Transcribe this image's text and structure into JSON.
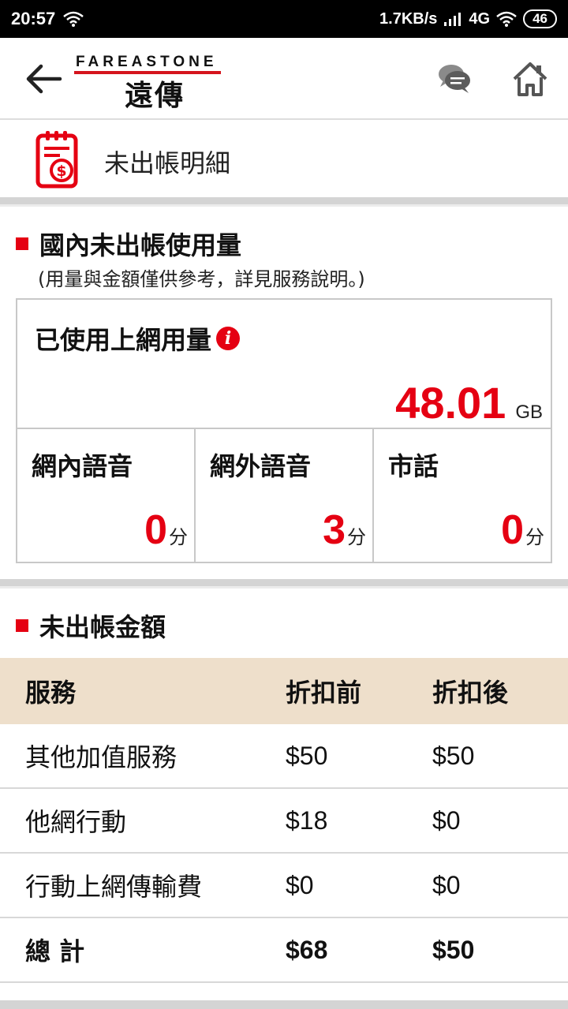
{
  "status": {
    "time": "20:57",
    "speed": "1.7KB/s",
    "network": "4G",
    "battery": "46"
  },
  "header": {
    "logo_text": "FAREASTONE",
    "logo_zh": "遠傳"
  },
  "page": {
    "title": "未出帳明細"
  },
  "usage": {
    "section_title": "國內未出帳使用量",
    "note": "(用量與金額僅供參考，詳見服務說明。)",
    "data_label": "已使用上網用量",
    "data_value": "48.01",
    "data_unit": "GB",
    "voice": [
      {
        "label": "網內語音",
        "value": "0",
        "unit": "分"
      },
      {
        "label": "網外語音",
        "value": "3",
        "unit": "分"
      },
      {
        "label": "市話",
        "value": "0",
        "unit": "分"
      }
    ]
  },
  "billing": {
    "section_title": "未出帳金額",
    "columns": [
      "服務",
      "折扣前",
      "折扣後"
    ],
    "rows": [
      {
        "service": "其他加值服務",
        "before": "$50",
        "after": "$50"
      },
      {
        "service": "他網行動",
        "before": "$18",
        "after": "$0"
      },
      {
        "service": "行動上網傳輸費",
        "before": "$0",
        "after": "$0"
      }
    ],
    "total": {
      "service": "總 計",
      "before": "$68",
      "after": "$50"
    }
  },
  "colors": {
    "accent": "#e50012",
    "table_header": "#eedfcb"
  }
}
